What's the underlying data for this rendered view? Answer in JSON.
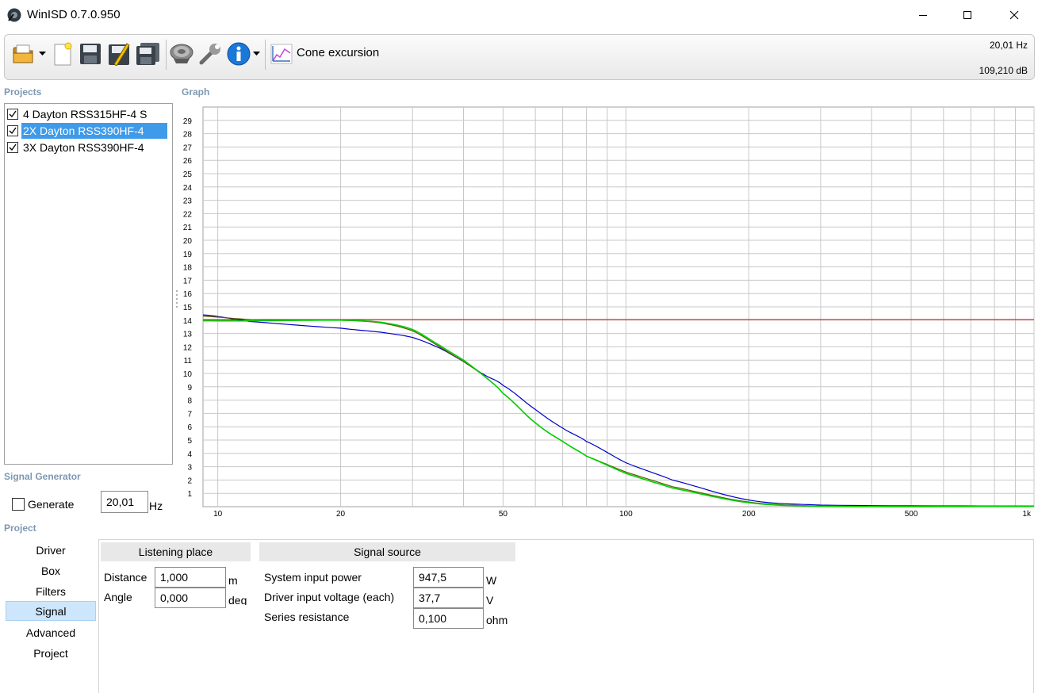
{
  "window": {
    "title": "WinISD 0.7.0.950",
    "icon": "speaker-icon",
    "controls": [
      "minimize-icon",
      "maximize-icon",
      "close-icon"
    ]
  },
  "toolbar": {
    "icons": [
      "open-folder-icon",
      "dropdown-arrow-icon",
      "new-document-icon",
      "save-icon",
      "save-as-icon",
      "save-all-icon",
      "driver-icon",
      "wrench-icon",
      "info-icon",
      "dropdown-arrow-icon",
      "chart-icon"
    ],
    "graph_type_label": "Cone excursion",
    "readout_freq": "20,01 Hz",
    "readout_db": "109,210 dB"
  },
  "projects": {
    "title": "Projects",
    "items": [
      {
        "label": "4 Dayton RSS315HF-4 S",
        "checked": true,
        "selected": false
      },
      {
        "label": "2X Dayton RSS390HF-4",
        "checked": true,
        "selected": true
      },
      {
        "label": "3X Dayton RSS390HF-4",
        "checked": true,
        "selected": false
      }
    ]
  },
  "graph": {
    "title": "Graph",
    "accent_colors": {
      "reference": "#e00000",
      "blue": "#0000c8",
      "green": "#00d000",
      "dark": "#5a5a00"
    }
  },
  "chart_data": {
    "type": "line",
    "title": "",
    "xlabel": "",
    "ylabel": "",
    "x_scale": "log",
    "xlim": [
      9.2,
      1000
    ],
    "ylim": [
      0,
      30
    ],
    "x_ticks": [
      10,
      20,
      50,
      100,
      200,
      500,
      1000
    ],
    "x_tick_labels": [
      "10",
      "20",
      "50",
      "100",
      "200",
      "500",
      "1k"
    ],
    "y_ticks": [
      1,
      2,
      3,
      4,
      5,
      6,
      7,
      8,
      9,
      10,
      11,
      12,
      13,
      14,
      15,
      16,
      17,
      18,
      19,
      20,
      21,
      22,
      23,
      24,
      25,
      26,
      27,
      28,
      29
    ],
    "grid": true,
    "legend": "none",
    "series": [
      {
        "color": "#e00000",
        "x": [
          9.2,
          30,
          1000
        ],
        "y": [
          14.05,
          14.05,
          14.05
        ]
      },
      {
        "color": "#0000c8",
        "x": [
          9.2,
          12,
          20,
          25,
          30,
          35,
          40,
          45,
          50,
          60,
          70,
          80,
          100,
          130,
          200,
          300,
          1000
        ],
        "y": [
          14.4,
          13.9,
          13.4,
          13.1,
          12.7,
          11.9,
          10.9,
          9.9,
          9.1,
          7.3,
          5.9,
          4.9,
          3.3,
          2.0,
          0.5,
          0.12,
          0.05
        ]
      },
      {
        "color": "#5a5a00",
        "x": [
          9.2,
          12,
          20,
          25,
          30,
          35,
          40,
          45,
          50,
          60,
          70,
          80,
          100,
          130,
          200,
          300,
          1000
        ],
        "y": [
          14.3,
          14.05,
          14.0,
          13.8,
          13.2,
          12.0,
          10.9,
          9.8,
          8.5,
          6.3,
          4.9,
          3.8,
          2.6,
          1.5,
          0.35,
          0.05,
          0.05
        ]
      },
      {
        "color": "#00d000",
        "x": [
          9.2,
          12,
          20,
          25,
          30,
          35,
          40,
          45,
          50,
          60,
          70,
          80,
          100,
          130,
          200,
          300,
          1000
        ],
        "y": [
          13.95,
          13.95,
          14.0,
          13.85,
          13.3,
          12.1,
          11.0,
          9.8,
          8.5,
          6.3,
          4.9,
          3.8,
          2.5,
          1.4,
          0.3,
          0.03,
          0.02
        ]
      }
    ]
  },
  "signal_generator": {
    "title": "Signal Generator",
    "generate_label": "Generate",
    "generate_checked": false,
    "frequency_value": "20,01",
    "frequency_unit": "Hz"
  },
  "project_nav": {
    "title": "Project",
    "items": [
      {
        "label": "Driver",
        "selected": false
      },
      {
        "label": "Box",
        "selected": false
      },
      {
        "label": "Filters",
        "selected": false
      },
      {
        "label": "Signal",
        "selected": true
      },
      {
        "label": "Advanced",
        "selected": false
      },
      {
        "label": "Project",
        "selected": false
      }
    ]
  },
  "listening_place": {
    "title": "Listening place",
    "distance_label": "Distance",
    "distance_value": "1,000",
    "distance_unit": "m",
    "angle_label": "Angle",
    "angle_value": "0,000",
    "angle_unit": "deg"
  },
  "signal_source": {
    "title": "Signal source",
    "power_label": "System input power",
    "power_value": "947,5",
    "power_unit": "W",
    "voltage_label": "Driver input voltage (each)",
    "voltage_value": "37,7",
    "voltage_unit": "V",
    "resistance_label": "Series resistance",
    "resistance_value": "0,100",
    "resistance_unit": "ohm"
  }
}
